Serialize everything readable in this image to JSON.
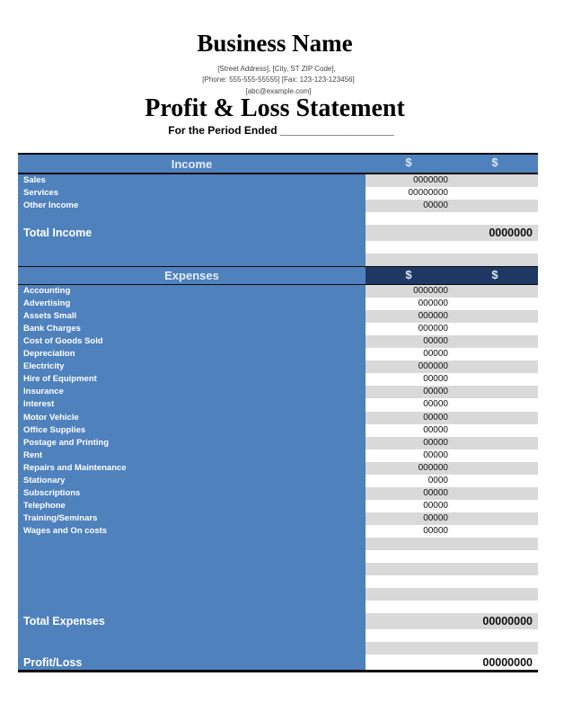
{
  "header": {
    "business_name": "Business Name",
    "address_line1": "[Street  Address], [City, ST ZIP Code],",
    "address_line2": "[Phone: 555-555-55555] [Fax: 123-123-123456]",
    "address_line3": "[abc@example.com]",
    "statement_title": "Profit & Loss Statement",
    "period_label": "For the Period Ended ___________________"
  },
  "income": {
    "title": "Income",
    "currency_col1": "$",
    "currency_col2": "$",
    "items": [
      {
        "label": "Sales",
        "value": "0000000"
      },
      {
        "label": "Services",
        "value": "00000000"
      },
      {
        "label": "Other Income",
        "value": "00000"
      }
    ],
    "total_label": "Total Income",
    "total_value": "0000000"
  },
  "expenses": {
    "title": "Expenses",
    "currency_col1": "$",
    "currency_col2": "$",
    "items": [
      {
        "label": "Accounting",
        "value": "0000000"
      },
      {
        "label": "Advertising",
        "value": "000000"
      },
      {
        "label": "Assets Small",
        "value": "000000"
      },
      {
        "label": "Bank Charges",
        "value": "000000"
      },
      {
        "label": "Cost of Goods Sold",
        "value": "00000"
      },
      {
        "label": "Depreciation",
        "value": "00000"
      },
      {
        "label": "Electricity",
        "value": "000000"
      },
      {
        "label": "Hire of Equipment",
        "value": "00000"
      },
      {
        "label": "Insurance",
        "value": "00000"
      },
      {
        "label": "Interest",
        "value": "00000"
      },
      {
        "label": "Motor Vehicle",
        "value": "00000"
      },
      {
        "label": "Office Supplies",
        "value": "00000"
      },
      {
        "label": "Postage  and Printing",
        "value": "00000"
      },
      {
        "label": "Rent",
        "value": "00000"
      },
      {
        "label": "Repairs and Maintenance",
        "value": "000000"
      },
      {
        "label": "Stationary",
        "value": "0000"
      },
      {
        "label": "Subscriptions",
        "value": "00000"
      },
      {
        "label": "Telephone",
        "value": "00000"
      },
      {
        "label": "Training/Seminars",
        "value": "00000"
      },
      {
        "label": "Wages and On costs",
        "value": "00000"
      }
    ],
    "total_label": "Total Expenses",
    "total_value": "00000000"
  },
  "profit_loss": {
    "label": "Profit/Loss",
    "value": "00000000"
  },
  "colors": {
    "label_column_blue": "#4f81bd",
    "expenses_value_header_navy": "#1f3864",
    "row_gray": "#d9d9d9"
  }
}
